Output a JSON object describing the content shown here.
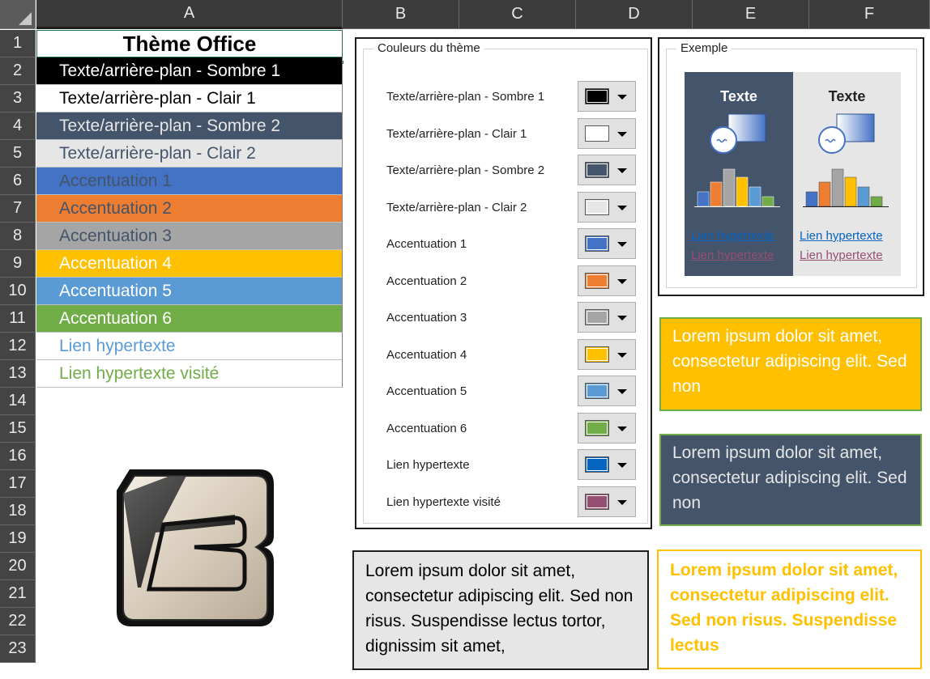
{
  "columns": [
    "A",
    "B",
    "C",
    "D",
    "E",
    "F"
  ],
  "rows": [
    "1",
    "2",
    "3",
    "4",
    "5",
    "6",
    "7",
    "8",
    "9",
    "10",
    "11",
    "12",
    "13",
    "14",
    "15",
    "16",
    "17",
    "18",
    "19",
    "20",
    "21",
    "22",
    "23"
  ],
  "cells": {
    "title": "Thème Office",
    "items": [
      {
        "label": "Texte/arrière-plan - Sombre 1",
        "bg": "#000000",
        "color": "#ffffff"
      },
      {
        "label": "Texte/arrière-plan - Clair 1",
        "bg": "#ffffff",
        "color": "#000000"
      },
      {
        "label": "Texte/arrière-plan - Sombre 2",
        "bg": "#44546a",
        "color": "#e7e6e6"
      },
      {
        "label": "Texte/arrière-plan - Clair 2",
        "bg": "#e7e6e6",
        "color": "#44546a"
      },
      {
        "label": "Accentuation 1",
        "bg": "#4472c4",
        "color": "#44546a"
      },
      {
        "label": "Accentuation 2",
        "bg": "#ed7d31",
        "color": "#44546a"
      },
      {
        "label": "Accentuation 3",
        "bg": "#a5a5a5",
        "color": "#44546a"
      },
      {
        "label": "Accentuation 4",
        "bg": "#ffc000",
        "color": "#ffffff"
      },
      {
        "label": "Accentuation 5",
        "bg": "#5b9bd5",
        "color": "#ffffff"
      },
      {
        "label": "Accentuation 6",
        "bg": "#70ad47",
        "color": "#ffffff"
      },
      {
        "label": "Lien hypertexte",
        "bg": "#ffffff",
        "color": "#5b9bd5"
      },
      {
        "label": "Lien hypertexte visité",
        "bg": "#ffffff",
        "color": "#70ad47"
      }
    ]
  },
  "dialog": {
    "legend": "Couleurs du thème",
    "rows": [
      {
        "label": "Texte/arrière-plan - Sombre 1",
        "swatch": "#000000"
      },
      {
        "label": "Texte/arrière-plan - Clair 1",
        "swatch": "#ffffff"
      },
      {
        "label": "Texte/arrière-plan - Sombre 2",
        "swatch": "#44546a"
      },
      {
        "label": "Texte/arrière-plan - Clair 2",
        "swatch": "#e7e6e6"
      },
      {
        "label": "Accentuation 1",
        "swatch": "#4472c4"
      },
      {
        "label": "Accentuation 2",
        "swatch": "#ed7d31"
      },
      {
        "label": "Accentuation 3",
        "swatch": "#a5a5a5"
      },
      {
        "label": "Accentuation 4",
        "swatch": "#ffc000"
      },
      {
        "label": "Accentuation 5",
        "swatch": "#5b9bd5"
      },
      {
        "label": "Accentuation 6",
        "swatch": "#70ad47"
      },
      {
        "label": "Lien hypertexte",
        "swatch": "#0563c1"
      },
      {
        "label": "Lien hypertexte visité",
        "swatch": "#954f72"
      }
    ]
  },
  "example": {
    "legend": "Exemple",
    "dark_title": "Texte",
    "light_title": "Texte",
    "link": "Lien hypertexte",
    "visited_link": "Lien hypertexte",
    "bar_colors": [
      "#4472c4",
      "#ed7d31",
      "#a5a5a5",
      "#ffc000",
      "#5b9bd5",
      "#70ad47"
    ]
  },
  "textboxes": {
    "yellow": "Lorem ipsum dolor sit amet, consectetur adipiscing elit. Sed non",
    "dark": "Lorem ipsum dolor sit amet, consectetur adipiscing elit. Sed non",
    "gray": "Lorem ipsum dolor sit amet, consectetur adipiscing elit. Sed non risus. Suspendisse lectus tortor, dignissim sit amet,",
    "outline": "Lorem ipsum dolor sit amet, consectetur adipiscing elit. Sed non risus. Suspendisse lectus"
  },
  "colors": {
    "accent": "#217346",
    "dark2": "#44546a",
    "light2": "#e7e6e6",
    "accent4": "#ffc000",
    "accent6": "#70ad47",
    "hyperlink": "#0563c1",
    "followed": "#954f72"
  },
  "logo": "app-logo-icon"
}
